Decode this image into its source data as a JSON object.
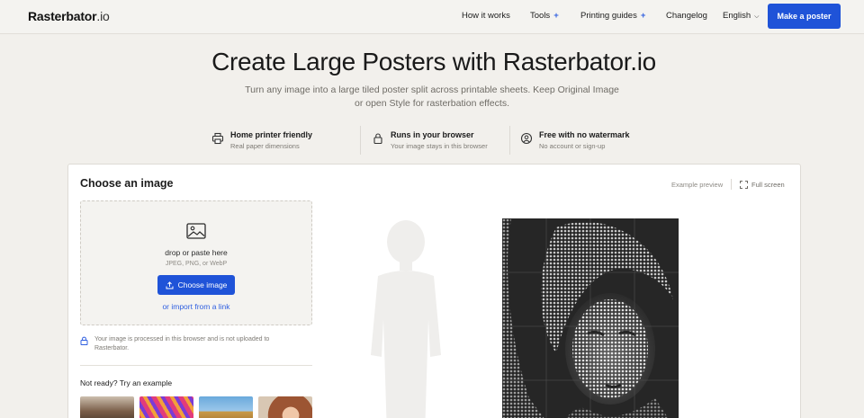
{
  "header": {
    "logo_name": "Rasterbator",
    "logo_tld": ".io",
    "nav": [
      {
        "label": "How it works",
        "plus": ""
      },
      {
        "label": "Tools",
        "plus": "+"
      },
      {
        "label": "Printing guides",
        "plus": "+"
      },
      {
        "label": "Changelog",
        "plus": ""
      }
    ],
    "language": "English",
    "cta": "Make a poster"
  },
  "hero": {
    "title": "Create Large Posters with Rasterbator.io",
    "subtitle": "Turn any image into a large tiled poster split across printable sheets. Keep Original Image or open Style for rasterbation effects."
  },
  "features": [
    {
      "icon": "printer-icon",
      "title": "Home printer friendly",
      "subtitle": "Real paper dimensions"
    },
    {
      "icon": "browser-lock-icon",
      "title": "Runs in your browser",
      "subtitle": "Your image stays in this browser"
    },
    {
      "icon": "badge-icon",
      "title": "Free with no watermark",
      "subtitle": "No account or sign-up"
    }
  ],
  "card": {
    "title": "Choose an image",
    "preview_label": "Example preview",
    "fullscreen_label": "Full screen",
    "dropzone": {
      "title": "drop or paste here",
      "formats": "JPEG, PNG, or WebP",
      "button": "Choose image",
      "import_link": "or import from a link"
    },
    "privacy_note": "Your image is processed in this browser and is not uploaded to Rasterbator.",
    "examples_title": "Not ready? Try an example",
    "examples": [
      {
        "name": "crowd",
        "color": "#8a6e5a"
      },
      {
        "name": "colorful-pattern",
        "color": "#d9366e"
      },
      {
        "name": "hay-bale",
        "color": "#5d98cf"
      },
      {
        "name": "portrait",
        "color": "#a5603f"
      }
    ]
  },
  "colors": {
    "accent": "#1f53d8",
    "link": "#2f5fe0",
    "page_bg": "#f2f0ec"
  }
}
